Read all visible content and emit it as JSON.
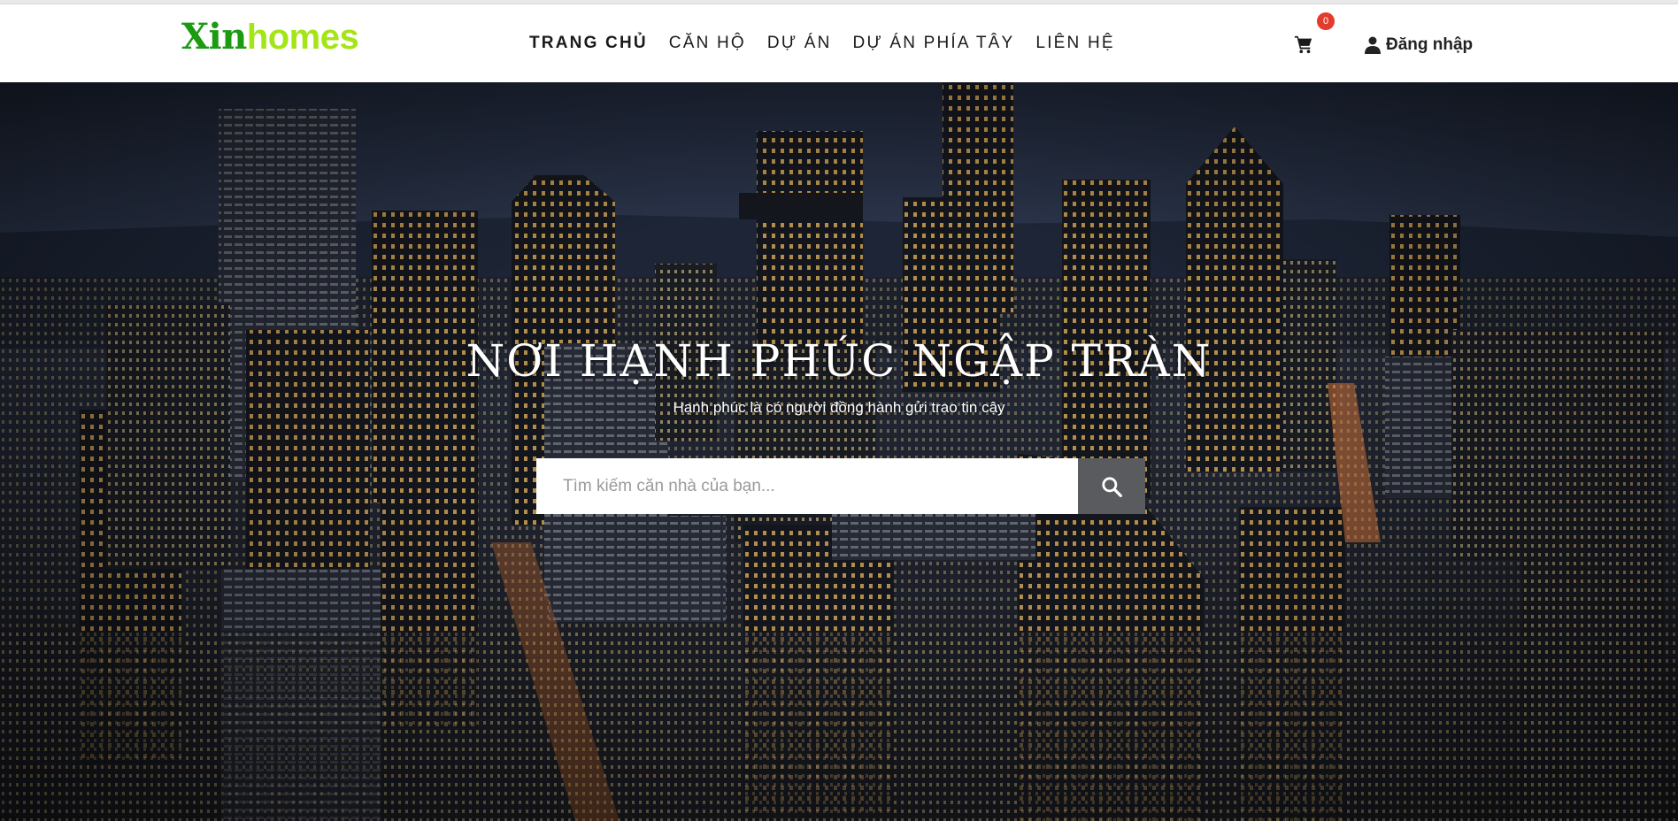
{
  "brand": {
    "part1": "Xin",
    "part2": "homes",
    "color1": "#1b9a12",
    "color2": "#a4e515"
  },
  "nav": {
    "items": [
      {
        "label": "TRANG CHỦ",
        "active": true
      },
      {
        "label": "CĂN HỘ",
        "active": false
      },
      {
        "label": "DỰ ÁN",
        "active": false
      },
      {
        "label": "DỰ ÁN PHÍA TÂY",
        "active": false
      },
      {
        "label": "LIÊN HỆ",
        "active": false
      }
    ]
  },
  "cart": {
    "icon": "cart-icon",
    "count": "0",
    "badge_color": "#e53b2c"
  },
  "login": {
    "icon": "user-icon",
    "label": "Đăng nhập"
  },
  "hero": {
    "background": "city-skyline-night-image",
    "headline": "NƠI HẠNH PHÚC NGẬP TRÀN",
    "subline": "Hạnh phúc là có người đồng hành gửi trao tin cậy"
  },
  "search": {
    "placeholder": "Tìm kiếm căn nhà của bạn...",
    "value": "",
    "button_icon": "search-icon"
  }
}
